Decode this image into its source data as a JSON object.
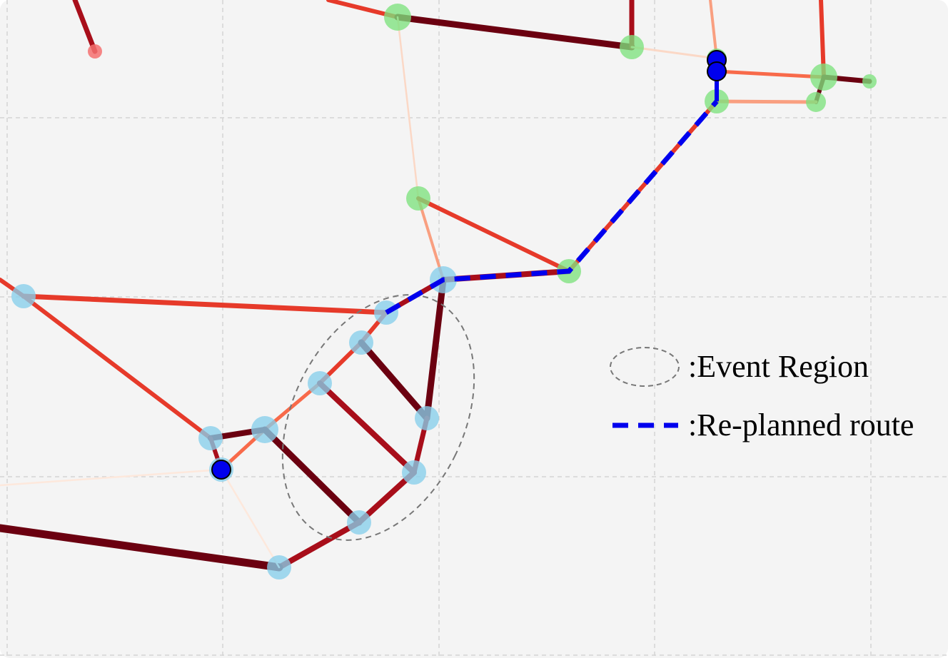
{
  "colors": {
    "background": "#f4f4f4",
    "grid": "#d4d4d4",
    "route": "#0000ee",
    "node_blue_region": "#87ceeb",
    "node_green_region": "#7ee27e",
    "node_start_end": "#0000ee",
    "event_region_outline": "#777777",
    "edge_heavy": "#6b0010",
    "edge_high": "#a80e1a",
    "edge_mid": "#e63a2a",
    "edge_medium": "#f86a4a",
    "edge_light": "#f99f80",
    "edge_faint": "#fbd8c6",
    "edge_very_faint": "#fde8dc"
  },
  "legend": {
    "event_region_label": ":Event Region",
    "route_label": ":Re-planned route"
  },
  "network": {
    "nodes": [
      {
        "id": "g1",
        "group": "green"
      },
      {
        "id": "g2",
        "group": "green"
      },
      {
        "id": "g3",
        "group": "green"
      },
      {
        "id": "g4",
        "group": "green"
      },
      {
        "id": "g5",
        "group": "green"
      },
      {
        "id": "g6",
        "group": "green"
      },
      {
        "id": "g7",
        "group": "green"
      },
      {
        "id": "g8",
        "group": "green"
      },
      {
        "id": "g9",
        "group": "green"
      },
      {
        "id": "b1",
        "group": "blue"
      },
      {
        "id": "b2",
        "group": "blue"
      },
      {
        "id": "b3",
        "group": "blue"
      },
      {
        "id": "b4",
        "group": "blue"
      },
      {
        "id": "b5",
        "group": "blue"
      },
      {
        "id": "b6",
        "group": "blue"
      },
      {
        "id": "b7",
        "group": "blue"
      },
      {
        "id": "b8",
        "group": "blue"
      },
      {
        "id": "b9",
        "group": "blue"
      },
      {
        "id": "b10",
        "group": "blue"
      },
      {
        "id": "b11",
        "group": "blue"
      },
      {
        "id": "b12",
        "group": "blue"
      },
      {
        "id": "b13",
        "group": "blue"
      },
      {
        "id": "r1",
        "group": "red"
      }
    ],
    "route_endpoints": [
      "b13",
      "g4"
    ],
    "route_path": [
      "b4",
      "b3",
      "g9",
      "g6",
      "g4"
    ]
  }
}
